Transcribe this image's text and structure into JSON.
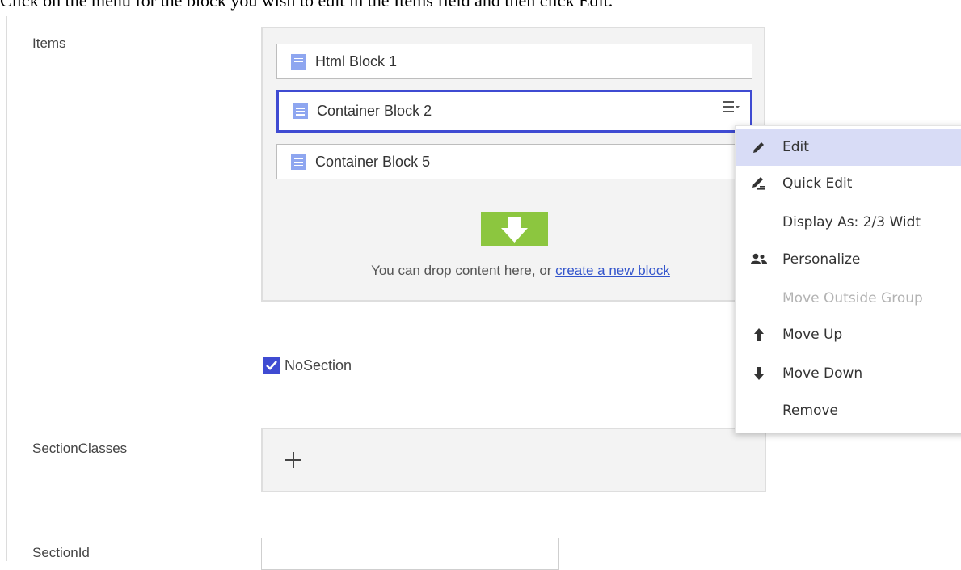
{
  "instruction": "Click on the menu for the block you wish to edit in the Items field and then click Edit.",
  "fields": {
    "items_label": "Items",
    "nosection_label": "NoSection",
    "nosection_checked": true,
    "sectionclasses_label": "SectionClasses",
    "sectionid_label": "SectionId",
    "sectionid_value": ""
  },
  "items": {
    "blocks": [
      {
        "label": "Html Block 1",
        "selected": false
      },
      {
        "label": "Container Block 2",
        "selected": true
      },
      {
        "label": "Container Block 5",
        "selected": false
      }
    ],
    "drop_text": "You can drop content here, or",
    "drop_link": "create a new block"
  },
  "context_menu": {
    "items": [
      {
        "label": "Edit",
        "icon": "pencil-icon",
        "state": "highlighted"
      },
      {
        "label": "Quick Edit",
        "icon": "quick-edit-pencil-icon",
        "state": "enabled"
      },
      {
        "label": "Display As: 2/3 Widt",
        "icon": "",
        "state": "enabled"
      },
      {
        "label": "Personalize",
        "icon": "people-icon",
        "state": "enabled"
      },
      {
        "label": "Move Outside Group",
        "icon": "",
        "state": "disabled"
      },
      {
        "label": "Move Up",
        "icon": "arrow-up-icon",
        "state": "enabled"
      },
      {
        "label": "Move Down",
        "icon": "arrow-down-icon",
        "state": "enabled"
      },
      {
        "label": "Remove",
        "icon": "",
        "state": "enabled"
      }
    ]
  },
  "colors": {
    "accent": "#3f4bd2",
    "drop_green": "#8cc63f",
    "block_icon": "#8ea6f0",
    "menu_highlight": "#d8dcf6",
    "link": "#3355cc"
  }
}
